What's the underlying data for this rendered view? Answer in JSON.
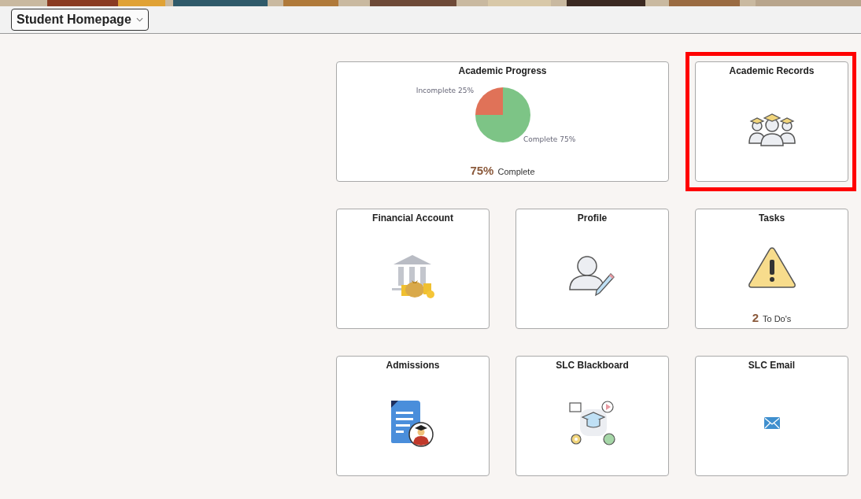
{
  "header": {
    "page_selector": "Student Homepage"
  },
  "tiles": [
    {
      "kind": "chart",
      "title": "Academic Progress",
      "highlighted": false,
      "summary_value": "75%",
      "summary_label": "Complete",
      "chart_data": {
        "type": "pie",
        "values": [
          25,
          75
        ],
        "colors": [
          "#e07258",
          "#7dc486"
        ],
        "value_labels": [
          "Incomplete 25%",
          "Complete 75%"
        ]
      }
    },
    {
      "kind": "icon",
      "title": "Academic Records",
      "highlighted": true
    },
    {
      "kind": "icon",
      "title": "Financial Account",
      "highlighted": false
    },
    {
      "kind": "icon",
      "title": "Profile",
      "highlighted": false
    },
    {
      "kind": "count",
      "title": "Tasks",
      "highlighted": false,
      "count": "2",
      "count_label": "To Do's"
    },
    {
      "kind": "icon",
      "title": "Admissions",
      "highlighted": false
    },
    {
      "kind": "icon",
      "title": "SLC Blackboard",
      "highlighted": false
    },
    {
      "kind": "icon",
      "title": "SLC Email",
      "highlighted": false
    }
  ]
}
